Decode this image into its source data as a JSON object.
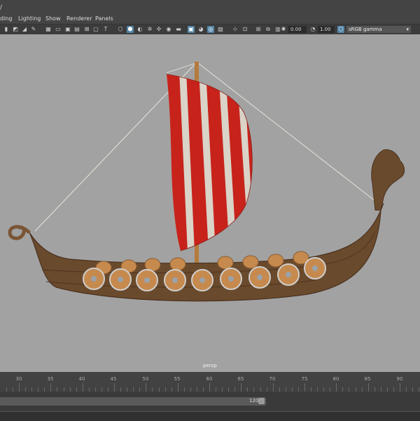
{
  "menu": {
    "items": [
      {
        "label": "ding"
      },
      {
        "label": "Lighting"
      },
      {
        "label": "Show"
      },
      {
        "label": "Renderer"
      },
      {
        "label": "Panels"
      }
    ]
  },
  "toolbar": {
    "field_a": "0.00",
    "field_b": "1.00",
    "color_space": "sRGB gamma"
  },
  "viewport": {
    "camera": "persp",
    "scene": "viking-longship",
    "colors": {
      "background": "#a2a2a2",
      "sail_red": "#c7231b",
      "sail_white": "#d9d3c8",
      "hull": "#6a4a2c"
    }
  },
  "timeline": {
    "ticks": [
      "30",
      "35",
      "40",
      "45",
      "50",
      "55",
      "60",
      "65",
      "70",
      "75",
      "80",
      "85",
      "90"
    ]
  },
  "range": {
    "end": "120"
  }
}
